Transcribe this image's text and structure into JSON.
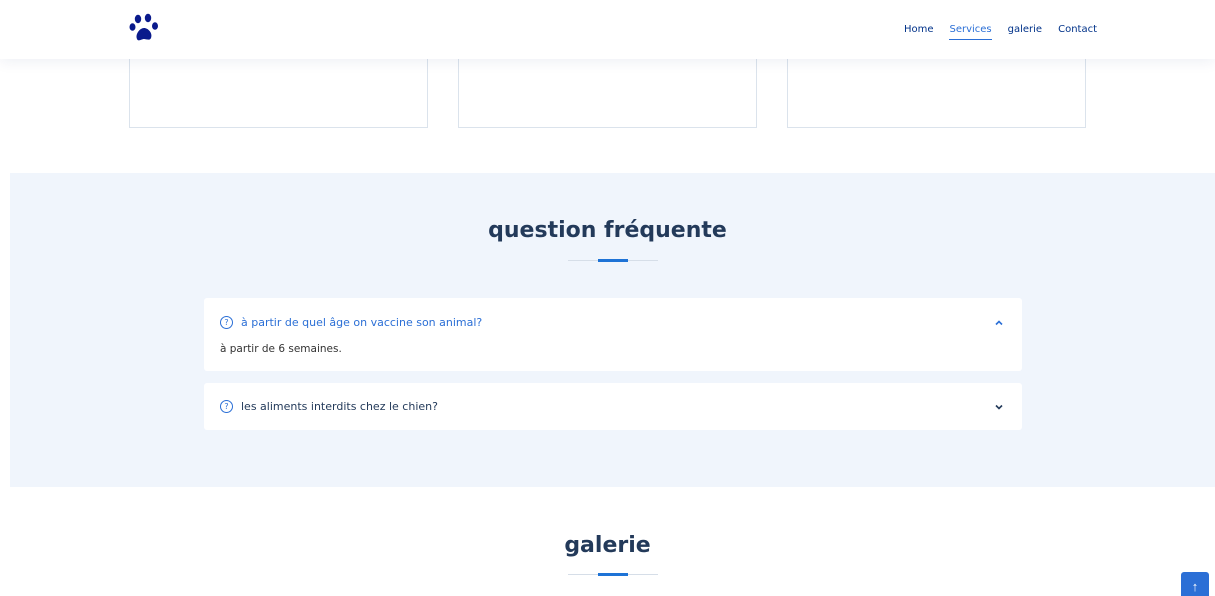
{
  "nav": {
    "items": [
      {
        "label": "Home",
        "active": false
      },
      {
        "label": "Services",
        "active": true
      },
      {
        "label": "galerie",
        "active": false
      },
      {
        "label": "Contact",
        "active": false
      }
    ]
  },
  "faq": {
    "title": "question fréquente",
    "items": [
      {
        "question": "à partir de quel âge on vaccine son animal?",
        "answer": "à partir de 6 semaines.",
        "expanded": true
      },
      {
        "question": "les aliments interdits chez le chien?",
        "expanded": false
      }
    ]
  },
  "galerie": {
    "title": "galerie"
  },
  "colors": {
    "accent": "#2b6fd6",
    "heading": "#233a5a",
    "section_bg": "#f0f5fc",
    "logo": "#0a1a8c"
  },
  "icons": {
    "logo": "paw-icon",
    "faq_question": "question-circle-icon",
    "expanded": "chevron-up-icon",
    "collapsed": "chevron-down-icon",
    "scroll_top": "arrow-up-icon"
  }
}
